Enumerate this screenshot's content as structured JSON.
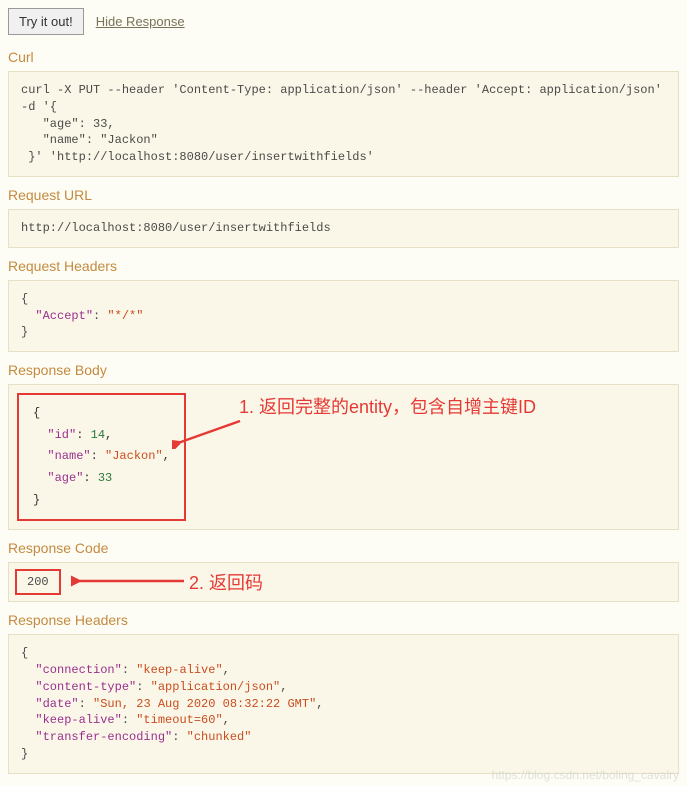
{
  "top": {
    "try_button": "Try it out!",
    "hide_link": "Hide Response"
  },
  "sections": {
    "curl": {
      "header": "Curl",
      "content": "curl -X PUT --header 'Content-Type: application/json' --header 'Accept: application/json' -d '{\n   \"age\": 33,\n   \"name\": \"Jackon\"\n }' 'http://localhost:8080/user/insertwithfields'"
    },
    "request_url": {
      "header": "Request URL",
      "content": "http://localhost:8080/user/insertwithfields"
    },
    "request_headers": {
      "header": "Request Headers",
      "accept_key": "\"Accept\"",
      "accept_val": "\"*/*\""
    },
    "response_body": {
      "header": "Response Body",
      "id_key": "\"id\"",
      "id_val": "14",
      "name_key": "\"name\"",
      "name_val": "\"Jackon\"",
      "age_key": "\"age\"",
      "age_val": "33"
    },
    "response_code": {
      "header": "Response Code",
      "content": "200"
    },
    "response_headers": {
      "header": "Response Headers",
      "connection_key": "\"connection\"",
      "connection_val": "\"keep-alive\"",
      "content_type_key": "\"content-type\"",
      "content_type_val": "\"application/json\"",
      "date_key": "\"date\"",
      "date_val": "\"Sun, 23 Aug 2020 08:32:22 GMT\"",
      "keep_alive_key": "\"keep-alive\"",
      "keep_alive_val": "\"timeout=60\"",
      "transfer_key": "\"transfer-encoding\"",
      "transfer_val": "\"chunked\""
    }
  },
  "annotations": {
    "annotation1": "1. 返回完整的entity，包含自增主键ID",
    "annotation2": "2. 返回码"
  },
  "watermark": "https://blog.csdn.net/boling_cavalry"
}
